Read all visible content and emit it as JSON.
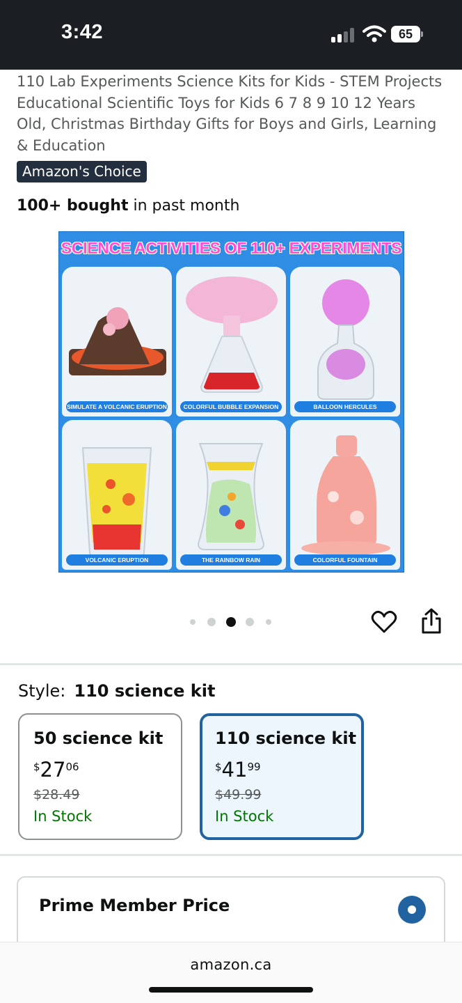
{
  "status_bar": {
    "time": "3:42",
    "battery": "65",
    "icons": [
      "signal-icon",
      "wifi-icon",
      "battery-icon"
    ]
  },
  "product": {
    "title": "110 Lab Experiments Science Kits for Kids - STEM Projects Educational Scientific Toys for Kids 6 7 8 9 10 12 Years Old, Christmas Birthday Gifts for Boys and Girls, Learning & Education",
    "badge": "Amazon's Choice",
    "bought_bold": "100+ bought",
    "bought_rest": " in past month"
  },
  "image": {
    "heading": "SCIENCE ACTIVITIES OF 110+ EXPERIMENTS",
    "captions": [
      "SIMULATE A VOLCANIC ERUPTION",
      "COLORFUL BUBBLE EXPANSION",
      "BALLOON HERCULES",
      "VOLCANIC ERUPTION",
      "THE RAINBOW RAIN",
      "COLORFUL FOUNTAIN"
    ]
  },
  "carousel": {
    "dot_count": 5,
    "active_index": 2,
    "actions": [
      "heart-icon",
      "share-icon"
    ]
  },
  "style_selector": {
    "label": "Style:",
    "value": "110 science kit",
    "options": [
      {
        "name": "50 science kit",
        "currency": "$",
        "whole": "27",
        "fraction": "06",
        "list_price": "$28.49",
        "stock": "In Stock",
        "selected": false
      },
      {
        "name": "110 science kit",
        "currency": "$",
        "whole": "41",
        "fraction": "99",
        "list_price": "$49.99",
        "stock": "In Stock",
        "selected": true
      }
    ]
  },
  "prime": {
    "label": "Prime Member Price"
  },
  "browser": {
    "domain": "amazon.ca"
  },
  "colors": {
    "badge_bg": "#232f3e",
    "in_stock": "#007600",
    "selected_border": "#2162a1",
    "selected_bg": "#edf6fd",
    "image_bg": "#2f8de4"
  }
}
